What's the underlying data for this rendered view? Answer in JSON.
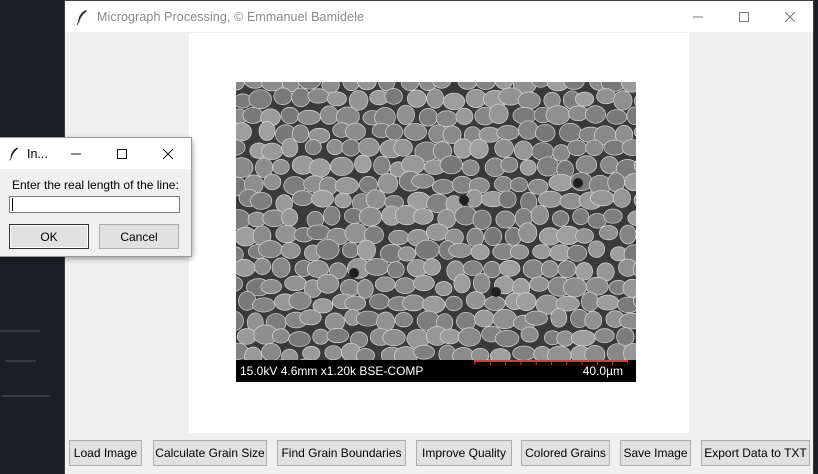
{
  "main_window": {
    "title": "Micrograph Processing,  © Emmanuel Bamidele",
    "icon": "feather-icon"
  },
  "image": {
    "info_text": "15.0kV 4.6mm x1.20k BSE-COMP",
    "scale_text": "40.0µm"
  },
  "toolbar": {
    "buttons": [
      {
        "label": "Load Image"
      },
      {
        "label": "Calculate Grain Size"
      },
      {
        "label": "Find Grain Boundaries"
      },
      {
        "label": "Improve Quality"
      },
      {
        "label": "Colored Grains"
      },
      {
        "label": "Save Image"
      },
      {
        "label": "Export Data to TXT"
      }
    ]
  },
  "dialog": {
    "title": "In...",
    "prompt": "Enter the real length of the line:",
    "input_value": "",
    "ok_label": "OK",
    "cancel_label": "Cancel"
  },
  "colors": {
    "scale_ruler": "#d23c3c",
    "window_bg": "#f0f0f0"
  }
}
